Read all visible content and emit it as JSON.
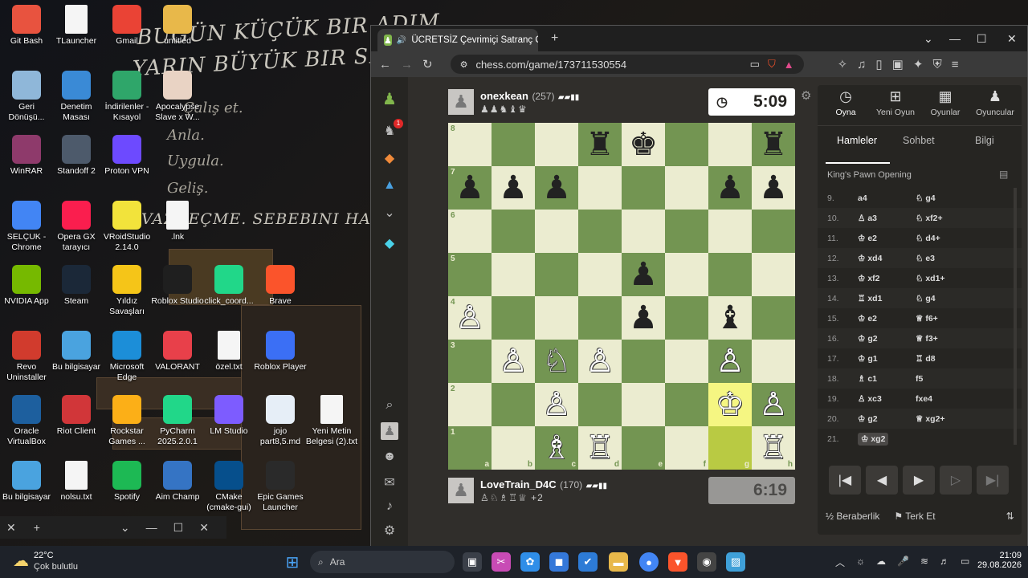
{
  "wallpaper": {
    "quote_line1": "BUGÜN KÜÇÜK BIR ADIM,",
    "quote_line2": "YARIN BÜYÜK BIR SEN.",
    "steps": [
      "Çalış et.",
      "Anla.",
      "Uygula.",
      "Geliş."
    ],
    "bottom_line": "VAZGEÇME. SEBEBINI HATIRLA."
  },
  "desktop_icons": [
    {
      "label": "Git Bash",
      "icon": "git-icon",
      "color": "#e8533f"
    },
    {
      "label": "TLauncher",
      "icon": "document-icon",
      "color": "#f5f5f5"
    },
    {
      "label": "Gmail",
      "icon": "gmail-icon",
      "color": "#ea4335"
    },
    {
      "label": "untitled",
      "icon": "folder-icon",
      "color": "#e8b84a"
    },
    {
      "label": "Geri Dönüşü...",
      "icon": "recycle-bin-icon",
      "color": "#8fb7d9"
    },
    {
      "label": "Denetim Masası",
      "icon": "control-panel-icon",
      "color": "#3a8ad6"
    },
    {
      "label": "İndirilenler - Kısayol",
      "icon": "downloads-folder-icon",
      "color": "#2fa66a"
    },
    {
      "label": "Apocalypse Slave x W...",
      "icon": "anime-image-icon",
      "color": "#e9d3c4"
    },
    {
      "label": "WinRAR",
      "icon": "winrar-icon",
      "color": "#8e3a6b"
    },
    {
      "label": "Standoff 2",
      "icon": "standoff-icon",
      "color": "#4d5a6b"
    },
    {
      "label": "Proton VPN",
      "icon": "proton-vpn-icon",
      "color": "#6d4aff"
    },
    {
      "label": "SELÇUK - Chrome",
      "icon": "chrome-icon",
      "color": "#4285f4"
    },
    {
      "label": "Opera GX tarayıcı",
      "icon": "opera-gx-icon",
      "color": "#fa1e4e"
    },
    {
      "label": "VRoidStudio 2.14.0",
      "icon": "vroid-icon",
      "color": "#f2e33b"
    },
    {
      "label": ".lnk",
      "icon": "document-icon",
      "color": "#f5f5f5"
    },
    {
      "label": "NVIDIA App",
      "icon": "nvidia-icon",
      "color": "#76b900"
    },
    {
      "label": "Steam",
      "icon": "steam-icon",
      "color": "#1b2838"
    },
    {
      "label": "Yıldız Savaşları",
      "icon": "brawl-stars-icon",
      "color": "#f5c518"
    },
    {
      "label": "Roblox Studio",
      "icon": "roblox-studio-icon",
      "color": "#1f1f1f"
    },
    {
      "label": "click_coord...",
      "icon": "pycharm-icon",
      "color": "#21d789"
    },
    {
      "label": "Brave",
      "icon": "brave-icon",
      "color": "#fb542b"
    },
    {
      "label": "Revo Uninstaller",
      "icon": "revo-icon",
      "color": "#d13b2d"
    },
    {
      "label": "Bu bilgisayar",
      "icon": "computer-icon",
      "color": "#4aa3df"
    },
    {
      "label": "Microsoft Edge",
      "icon": "edge-icon",
      "color": "#1c8ed8"
    },
    {
      "label": "VALORANT",
      "icon": "valorant-icon",
      "color": "#e8404a"
    },
    {
      "label": "özel.txt",
      "icon": "document-icon",
      "color": "#f5f5f5"
    },
    {
      "label": "Roblox Player",
      "icon": "roblox-icon",
      "color": "#3b6ff5"
    },
    {
      "label": "Oracle VirtualBox",
      "icon": "virtualbox-icon",
      "color": "#1d5f9e"
    },
    {
      "label": "Riot Client",
      "icon": "riot-icon",
      "color": "#d13639"
    },
    {
      "label": "Rockstar Games ...",
      "icon": "rockstar-icon",
      "color": "#fcaf17"
    },
    {
      "label": "PyCharm 2025.2.0.1",
      "icon": "pycharm-icon",
      "color": "#21d789"
    },
    {
      "label": "LM Studio",
      "icon": "lm-studio-icon",
      "color": "#7d5cff"
    },
    {
      "label": "jojo part8,5.md",
      "icon": "markdown-icon",
      "color": "#e6eef7"
    },
    {
      "label": "Yeni Metin Belgesi (2).txt",
      "icon": "document-icon",
      "color": "#f5f5f5"
    },
    {
      "label": "Bu bilgisayar",
      "icon": "computer-icon",
      "color": "#4aa3df"
    },
    {
      "label": "nolsu.txt",
      "icon": "document-icon",
      "color": "#f5f5f5"
    },
    {
      "label": "Spotify",
      "icon": "spotify-icon",
      "color": "#1db954"
    },
    {
      "label": "Aim Champ",
      "icon": "aim-champ-icon",
      "color": "#3574c4"
    },
    {
      "label": "CMake (cmake-gui)",
      "icon": "cmake-icon",
      "color": "#064f8c"
    },
    {
      "label": "Epic Games Launcher",
      "icon": "epic-games-icon",
      "color": "#2a2a2a"
    }
  ],
  "browser": {
    "tab_title": "ÜCRETSİZ Çevrimiçi Satranç O",
    "url": "chess.com/game/173711530554"
  },
  "game": {
    "top_player": {
      "name": "onexkean",
      "rating": "(257)",
      "captured": "♟♟♞♝♛",
      "clock": "5:09",
      "clock_colors": {
        "bg": "#ffffff",
        "fg": "#262421"
      }
    },
    "bottom_player": {
      "name": "LoveTrain_D4C",
      "rating": "(170)",
      "captured": "♙♘♗♖♕",
      "advantage": "+2",
      "clock": "6:19",
      "clock_colors": {
        "bg": "#989795",
        "fg": "#4c4b49"
      }
    },
    "ranks": [
      "8",
      "7",
      "6",
      "5",
      "4",
      "3",
      "2",
      "1"
    ],
    "files": [
      "a",
      "b",
      "c",
      "d",
      "e",
      "f",
      "g",
      "h"
    ],
    "pieces": [
      {
        "sq": "d8",
        "p": "♜",
        "c": "b"
      },
      {
        "sq": "e8",
        "p": "♚",
        "c": "b"
      },
      {
        "sq": "h8",
        "p": "♜",
        "c": "b"
      },
      {
        "sq": "a7",
        "p": "♟",
        "c": "b"
      },
      {
        "sq": "b7",
        "p": "♟",
        "c": "b"
      },
      {
        "sq": "c7",
        "p": "♟",
        "c": "b"
      },
      {
        "sq": "g7",
        "p": "♟",
        "c": "b"
      },
      {
        "sq": "h7",
        "p": "♟",
        "c": "b"
      },
      {
        "sq": "e5",
        "p": "♟",
        "c": "b"
      },
      {
        "sq": "e4",
        "p": "♟",
        "c": "b"
      },
      {
        "sq": "g4",
        "p": "♝",
        "c": "b"
      },
      {
        "sq": "a4",
        "p": "♙",
        "c": "w"
      },
      {
        "sq": "b3",
        "p": "♙",
        "c": "w"
      },
      {
        "sq": "c3",
        "p": "♘",
        "c": "w"
      },
      {
        "sq": "d3",
        "p": "♙",
        "c": "w"
      },
      {
        "sq": "g3",
        "p": "♙",
        "c": "w"
      },
      {
        "sq": "c2",
        "p": "♙",
        "c": "w"
      },
      {
        "sq": "g2",
        "p": "♔",
        "c": "w"
      },
      {
        "sq": "h2",
        "p": "♙",
        "c": "w"
      },
      {
        "sq": "c1",
        "p": "♗",
        "c": "w"
      },
      {
        "sq": "d1",
        "p": "♖",
        "c": "w"
      },
      {
        "sq": "h1",
        "p": "♖",
        "c": "w"
      }
    ],
    "highlight": {
      "from": "g1",
      "to": "g2"
    }
  },
  "panel": {
    "top_buttons": [
      {
        "label": "Oyna",
        "icon": "stopwatch-icon"
      },
      {
        "label": "Yeni Oyun",
        "icon": "plus-icon"
      },
      {
        "label": "Oyunlar",
        "icon": "board-icon"
      },
      {
        "label": "Oyuncular",
        "icon": "players-icon"
      }
    ],
    "tabs": [
      "Hamleler",
      "Sohbet",
      "Bilgi"
    ],
    "opening": "King's Pawn Opening",
    "moves": [
      {
        "n": "9.",
        "w": "a4",
        "b": "♘ g4"
      },
      {
        "n": "10.",
        "w": "♙ a3",
        "b": "♘ xf2+"
      },
      {
        "n": "11.",
        "w": "♔ e2",
        "b": "♘ d4+"
      },
      {
        "n": "12.",
        "w": "♔ xd4",
        "b": "♘ e3"
      },
      {
        "n": "13.",
        "w": "♔ xf2",
        "b": "♘ xd1+"
      },
      {
        "n": "14.",
        "w": "♖ xd1",
        "b": "♘ g4"
      },
      {
        "n": "15.",
        "w": "♔ e2",
        "b": "♕ f6+"
      },
      {
        "n": "16.",
        "w": "♔ g2",
        "b": "♕ f3+"
      },
      {
        "n": "17.",
        "w": "♔ g1",
        "b": "♖ d8"
      },
      {
        "n": "18.",
        "w": "♗ c1",
        "b": "f5"
      },
      {
        "n": "19.",
        "w": "♙ xc3",
        "b": "fxe4"
      },
      {
        "n": "20.",
        "w": "♔ g2",
        "b": "♕ xg2+"
      },
      {
        "n": "21.",
        "w": "♔ xg2",
        "b": ""
      }
    ],
    "draw_label": "Beraberlik",
    "resign_label": "Terk Et"
  },
  "taskbar": {
    "weather_temp": "22°C",
    "weather_desc": "Çok bulutlu",
    "search_placeholder": "Ara",
    "time": "21:09",
    "date": "29.08.2026"
  }
}
